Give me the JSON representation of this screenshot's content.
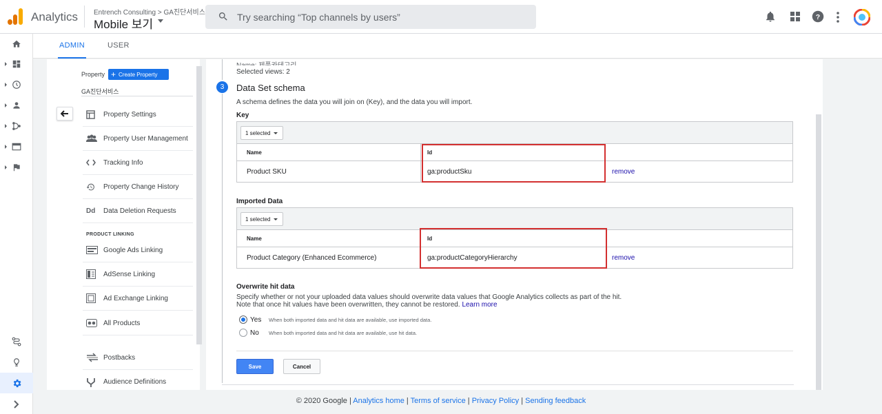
{
  "app": {
    "title": "Analytics"
  },
  "account": {
    "path": "Entrench Consulting > GA진단서비스",
    "view": "Mobile 보기"
  },
  "search": {
    "placeholder": "Try searching “Top channels by users”"
  },
  "tabs": {
    "admin": "ADMIN",
    "user": "USER"
  },
  "property": {
    "label": "Property",
    "create_label": "Create Property",
    "name": "GA진단서비스",
    "menu": [
      {
        "label": "Property Settings",
        "icon": "property-settings-icon"
      },
      {
        "label": "Property User Management",
        "icon": "people-icon"
      },
      {
        "label": "Tracking Info",
        "icon": "code-icon"
      },
      {
        "label": "Property Change History",
        "icon": "history-icon"
      },
      {
        "label": "Data Deletion Requests",
        "icon": "dd-icon"
      }
    ],
    "linking_header": "PRODUCT LINKING",
    "linking": [
      {
        "label": "Google Ads Linking",
        "icon": "google-ads-icon"
      },
      {
        "label": "AdSense Linking",
        "icon": "adsense-icon"
      },
      {
        "label": "Ad Exchange Linking",
        "icon": "ad-exchange-icon"
      },
      {
        "label": "All Products",
        "icon": "all-products-icon"
      }
    ],
    "other": [
      {
        "label": "Postbacks",
        "icon": "postbacks-icon"
      },
      {
        "label": "Audience Definitions",
        "icon": "audience-icon"
      }
    ]
  },
  "form": {
    "prev_name": "Name: 제품카테고리",
    "prev_views": "Selected views: 2",
    "step_number": "3",
    "step_title": "Data Set schema",
    "step_desc": "A schema defines the data you will join on (Key), and the data you will import.",
    "key": {
      "label": "Key",
      "selected": "1 selected",
      "headers": {
        "name": "Name",
        "id": "Id"
      },
      "row": {
        "name": "Product SKU",
        "id": "ga:productSku",
        "action": "remove"
      }
    },
    "imported": {
      "label": "Imported Data",
      "selected": "1 selected",
      "headers": {
        "name": "Name",
        "id": "Id"
      },
      "row": {
        "name": "Product Category (Enhanced Ecommerce)",
        "id": "ga:productCategoryHierarchy",
        "action": "remove"
      }
    },
    "overwrite": {
      "title": "Overwrite hit data",
      "desc1": "Specify whether or not your uploaded data values should overwrite data values that Google Analytics collects as part of the hit.",
      "desc2": "Note that once hit values have been overwritten, they cannot be restored.",
      "learn_more": "Learn more",
      "yes_label": "Yes",
      "yes_help": "When both imported data and hit data are available, use imported data.",
      "no_label": "No",
      "no_help": "When both imported data and hit data are available, use hit data.",
      "selected": "Yes"
    },
    "save": "Save",
    "cancel": "Cancel"
  },
  "footer": {
    "copyright": "© 2020 Google",
    "links": [
      "Analytics home",
      "Terms of service",
      "Privacy Policy",
      "Sending feedback"
    ]
  },
  "colors": {
    "accent": "#1a73e8",
    "highlight": "#d32f2f",
    "save": "#4285f4"
  }
}
